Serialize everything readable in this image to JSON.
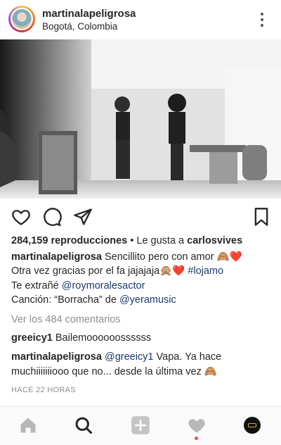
{
  "header": {
    "username": "martinalapeligrosa",
    "location": "Bogotá, Colombia"
  },
  "stats": {
    "views": "284,159 reproducciones",
    "liked_by_prefix": "Le gusta a",
    "liked_by_user": "carlosvives"
  },
  "caption": {
    "author": "martinalapeligrosa",
    "line1": "Sencillito pero con amor 🙈❤️",
    "line2": "Otra vez gracias por el fa jajajaja🙊❤️",
    "hashtag": "#lojamo",
    "line3_prefix": "Te extrañé",
    "mention1": "@roymoralesactor",
    "line4_prefix": "Canción: “Borracha” de",
    "mention2": "@yeramusic"
  },
  "view_comments": "Ver los 484 comentarios",
  "comments": [
    {
      "user": "greeicy1",
      "text": "Bailemoooooossssss"
    },
    {
      "user": "martinalapeligrosa",
      "mention": "@greeicy1",
      "text": "Vapa. Ya hace",
      "text2": "muchiiiiiiiooo que no... desde la última vez 🙈"
    }
  ],
  "timestamp": "HACE 22 HORAS",
  "icons": {
    "actions": [
      "heart-icon",
      "comment-icon",
      "share-icon",
      "bookmark-icon"
    ],
    "nav": [
      "home-icon",
      "search-icon",
      "add-icon",
      "activity-icon",
      "profile-icon"
    ]
  },
  "colors": {
    "link": "#1a3a6e",
    "muted": "#8e8e8e",
    "notification": "#ed4956"
  }
}
